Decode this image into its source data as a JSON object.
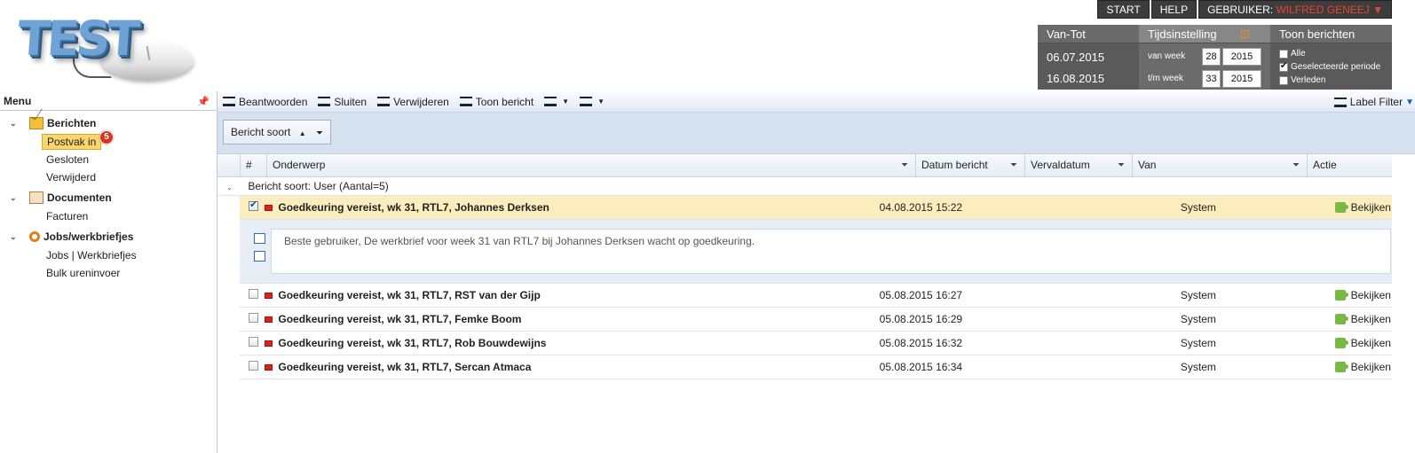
{
  "logo": {
    "text": "TEST"
  },
  "topnav": {
    "start": "START",
    "help": "HELP",
    "user_label": "GEBRUIKER:",
    "user_name": "WILFRED GENEEJ ▼"
  },
  "period": {
    "vantot_label": "Van-Tot",
    "date_from": "06.07.2015",
    "date_to": "16.08.2015",
    "tijd_label": "Tijdsinstelling",
    "van_week_label": "van week",
    "tm_week_label": "t/m week",
    "van_week": "28",
    "van_year": "2015",
    "tm_week": "33",
    "tm_year": "2015",
    "toon_label": "Toon berichten",
    "options": [
      {
        "label": "Alle",
        "checked": false
      },
      {
        "label": "Geselecteerde periode",
        "checked": true
      },
      {
        "label": "Verleden",
        "checked": false
      }
    ]
  },
  "sidebar": {
    "title": "Menu",
    "pin": "ᵽ",
    "groups": [
      {
        "label": "Berichten",
        "icon": "envelope-icon",
        "items": [
          "Postvak in",
          "Gesloten",
          "Verwijderd"
        ]
      },
      {
        "label": "Documenten",
        "icon": "documents-icon",
        "items": [
          "Facturen"
        ]
      },
      {
        "label": "Jobs/werkbriefjes",
        "icon": "jobs-icon",
        "items": [
          "Jobs | Werkbriefjes",
          "Bulk ureninvoer"
        ]
      }
    ],
    "inbox_badge": "5"
  },
  "toolbar": {
    "beantwoorden": "Beantwoorden",
    "sluiten": "Sluiten",
    "verwijderen": "Verwijderen",
    "toon_bericht": "Toon bericht",
    "label_filter": "Label Filter"
  },
  "group_panel": {
    "chip": "Bericht soort"
  },
  "grid": {
    "headers": {
      "num": "#",
      "onderwerp": "Onderwerp",
      "datum": "Datum bericht",
      "verval": "Vervaldatum",
      "van": "Van",
      "actie": "Actie"
    },
    "group_row": "Bericht soort: User (Aantal=5)",
    "rows": [
      {
        "subject": "Goedkeuring vereist, wk 31, RTL7, Johannes Derksen",
        "date": "04.08.2015 15:22",
        "van": "System",
        "action": "Bekijken",
        "checked": true
      },
      {
        "subject": "Goedkeuring vereist, wk 31, RTL7, RST van der Gijp",
        "date": "05.08.2015 16:27",
        "van": "System",
        "action": "Bekijken",
        "checked": false
      },
      {
        "subject": "Goedkeuring vereist, wk 31, RTL7, Femke Boom",
        "date": "05.08.2015 16:29",
        "van": "System",
        "action": "Bekijken",
        "checked": false
      },
      {
        "subject": "Goedkeuring vereist, wk 31, RTL7, Rob Bouwdewijns",
        "date": "05.08.2015 16:32",
        "van": "System",
        "action": "Bekijken",
        "checked": false
      },
      {
        "subject": "Goedkeuring vereist, wk 31, RTL7, Sercan Atmaca",
        "date": "05.08.2015 16:34",
        "van": "System",
        "action": "Bekijken",
        "checked": false
      }
    ],
    "detail_text": "Beste gebruiker, De werkbrief voor week 31 van RTL7 bij Johannes Derksen wacht op goedkeuring."
  }
}
